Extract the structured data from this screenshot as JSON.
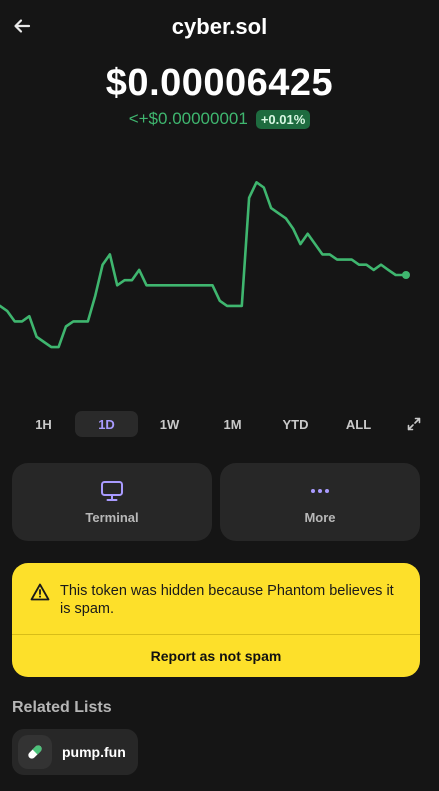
{
  "header": {
    "title": "cyber.sol",
    "back_icon": "arrow-left-icon"
  },
  "price": {
    "value": "$0.00006425",
    "change": "<+$0.00000001",
    "change_pct": "+0.01%"
  },
  "colors": {
    "background": "#151515",
    "positive": "#3fb66f",
    "accent": "#a99bff",
    "warning_bg": "#fde02a",
    "card_bg": "#272727"
  },
  "chart_data": {
    "type": "line",
    "title": "",
    "xlabel": "",
    "ylabel": "",
    "grid": false,
    "series": [
      {
        "values": [
          0.64,
          0.63,
          0.61,
          0.61,
          0.62,
          0.58,
          0.57,
          0.56,
          0.56,
          0.6,
          0.61,
          0.61,
          0.61,
          0.66,
          0.72,
          0.74,
          0.68,
          0.69,
          0.69,
          0.71,
          0.68,
          0.68,
          0.68,
          0.68,
          0.68,
          0.68,
          0.68,
          0.68,
          0.68,
          0.68,
          0.65,
          0.64,
          0.64,
          0.64,
          0.85,
          0.88,
          0.87,
          0.83,
          0.82,
          0.81,
          0.79,
          0.76,
          0.78,
          0.76,
          0.74,
          0.74,
          0.73,
          0.73,
          0.73,
          0.72,
          0.72,
          0.71,
          0.72,
          0.71,
          0.7,
          0.7
        ]
      }
    ]
  },
  "ranges": [
    "1H",
    "1D",
    "1W",
    "1M",
    "YTD",
    "ALL"
  ],
  "active_range": "1D",
  "actions": {
    "terminal_label": "Terminal",
    "more_label": "More"
  },
  "spam": {
    "message": "This token was hidden because Phantom believes it is spam.",
    "report_label": "Report as not spam"
  },
  "related": {
    "title": "Related Lists",
    "item_label": "pump.fun"
  }
}
